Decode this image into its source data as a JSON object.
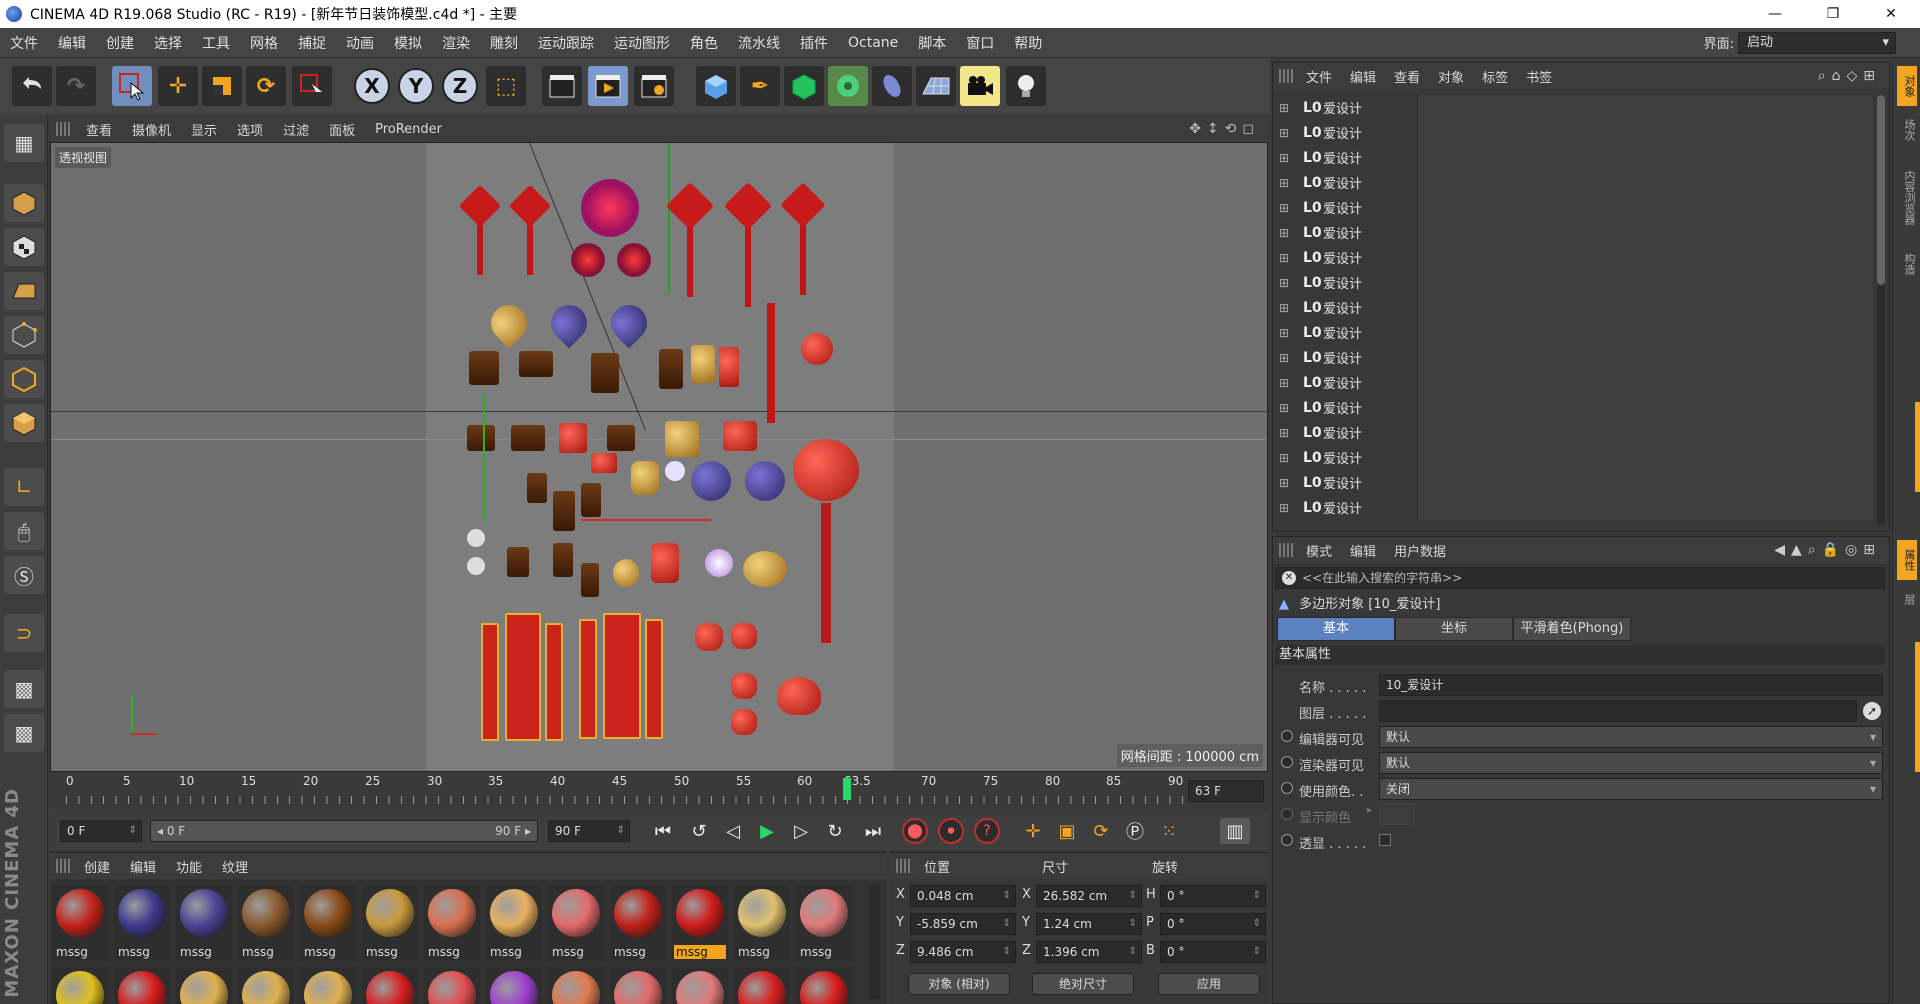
{
  "window": {
    "title": "CINEMA 4D R19.068 Studio (RC - R19) - [新年节日装饰模型.c4d *] - 主要",
    "minimize": "—",
    "restore": "❐",
    "close": "✕"
  },
  "menubar": {
    "items": [
      "文件",
      "编辑",
      "创建",
      "选择",
      "工具",
      "网格",
      "捕捉",
      "动画",
      "模拟",
      "渲染",
      "雕刻",
      "运动跟踪",
      "运动图形",
      "角色",
      "流水线",
      "插件",
      "Octane",
      "脚本",
      "窗口",
      "帮助"
    ],
    "layout_label": "界面:",
    "layout_value": "启动"
  },
  "viewport": {
    "menu": [
      "查看",
      "摄像机",
      "显示",
      "选项",
      "过滤",
      "面板",
      "ProRender"
    ],
    "label": "透视视图",
    "grid_info": "网格间距 : 100000 cm"
  },
  "timeline": {
    "ticks": [
      "0",
      "5",
      "10",
      "15",
      "20",
      "25",
      "30",
      "35",
      "40",
      "45",
      "50",
      "55",
      "60",
      "63.5",
      "70",
      "75",
      "80",
      "85",
      "90"
    ],
    "current_frame_field": "63 F",
    "playhead_frame": 63,
    "max_frame": 90
  },
  "transport": {
    "start_field": "0 F",
    "range_start": "◂ 0 F",
    "range_end": "90 F ▸",
    "end_field": "90 F"
  },
  "materials": {
    "menu": [
      "创建",
      "编辑",
      "功能",
      "纹理"
    ],
    "label": "mssg",
    "row1_colors": [
      "#c4241a",
      "#3e3a8e",
      "#4b4596",
      "#8a5a2e",
      "#8a4a16",
      "#c99a3c",
      "#d97050",
      "#e8b060",
      "#e46a6a",
      "#c02218",
      "#d01c1c",
      "#e0c070",
      "#e07a7a"
    ],
    "row2_colors": [
      "#e0c020",
      "#d81c1c",
      "#e0b050",
      "#e0b050",
      "#e0b050",
      "#d82020",
      "#e05050",
      "#a040d0",
      "#e07a50",
      "#e06a6a",
      "#e07a7a",
      "#d82020",
      "#d81c1c"
    ],
    "active_index": 10
  },
  "coordinates": {
    "headers": [
      "位置",
      "尺寸",
      "旋转"
    ],
    "rows": [
      {
        "axis": "X",
        "pos": "0.048 cm",
        "size_axis": "X",
        "size": "26.582 cm",
        "rot_axis": "H",
        "rot": "0 °"
      },
      {
        "axis": "Y",
        "pos": "-5.859 cm",
        "size_axis": "Y",
        "size": "1.24 cm",
        "rot_axis": "P",
        "rot": "0 °"
      },
      {
        "axis": "Z",
        "pos": "9.486 cm",
        "size_axis": "Z",
        "size": "1.396 cm",
        "rot_axis": "B",
        "rot": "0 °"
      }
    ],
    "mode": "对象 (相对)",
    "size_mode": "绝对尺寸",
    "apply": "应用"
  },
  "object_manager": {
    "menu": [
      "文件",
      "编辑",
      "查看",
      "对象",
      "标签",
      "书签"
    ],
    "row_icon": "L0",
    "rows": [
      "爱设计",
      "爱设计",
      "爱设计",
      "爱设计",
      "爱设计",
      "爱设计",
      "爱设计",
      "爱设计",
      "爱设计",
      "爱设计",
      "爱设计",
      "爱设计",
      "爱设计",
      "爱设计",
      "爱设计",
      "爱设计",
      "爱设计"
    ]
  },
  "side_tabs": [
    "对象",
    "场次",
    "内容浏览器",
    "构造"
  ],
  "side_tabs_bottom": [
    "属性",
    "层"
  ],
  "attributes": {
    "menu": [
      "模式",
      "编辑",
      "用户数据"
    ],
    "search_placeholder": "<<在此输入搜索的字符串>>",
    "object_header": "多边形对象 [10_爱设计]",
    "tabs": [
      "基本",
      "坐标",
      "平滑着色(Phong)"
    ],
    "section": "基本属性",
    "props": {
      "name_label": "名称 . . . . .",
      "name_value": "10_爱设计",
      "layer_label": "图层 . . . . .",
      "editor_label": "编辑器可见",
      "editor_value": "默认",
      "render_label": "渲染器可见",
      "render_value": "默认",
      "color_label": "使用颜色. .",
      "color_value": "关闭",
      "display_color_label": "显示颜色",
      "xray_label": "透显 . . . . ."
    }
  }
}
